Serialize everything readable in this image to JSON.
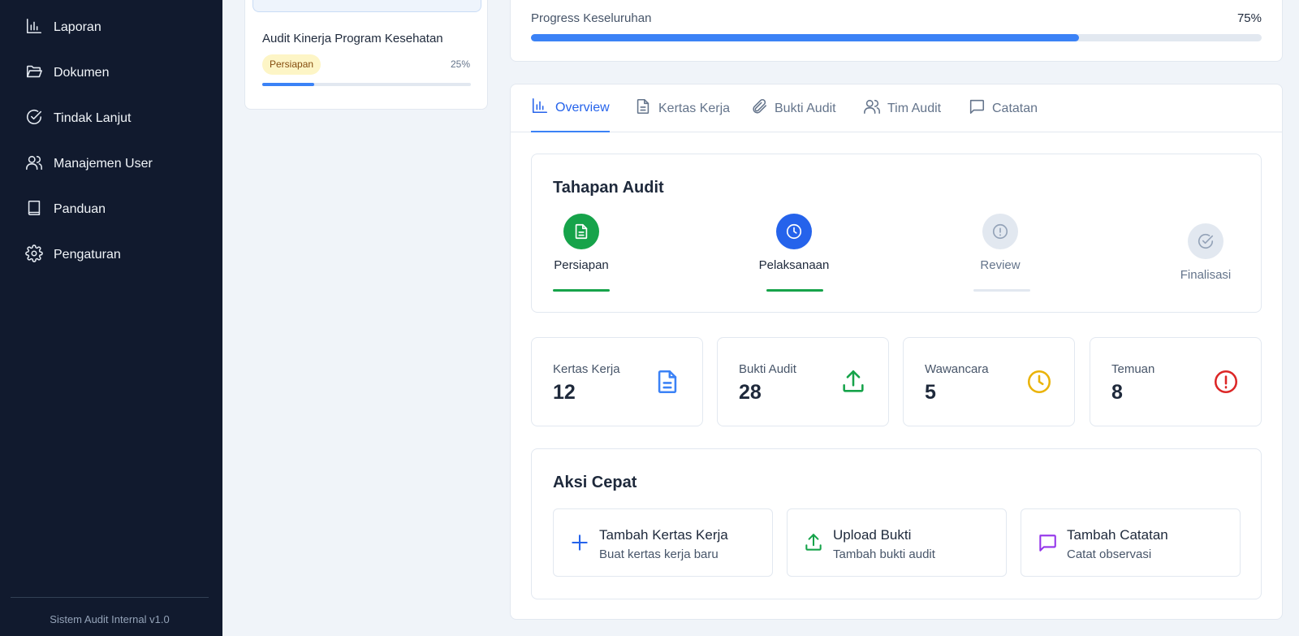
{
  "sidebar": {
    "items": [
      {
        "label": "Laporan",
        "icon": "bar-chart-icon"
      },
      {
        "label": "Dokumen",
        "icon": "folder-open-icon"
      },
      {
        "label": "Tindak Lanjut",
        "icon": "check-circle-icon"
      },
      {
        "label": "Manajemen User",
        "icon": "users-icon"
      },
      {
        "label": "Panduan",
        "icon": "book-icon"
      },
      {
        "label": "Pengaturan",
        "icon": "gear-icon"
      }
    ],
    "footer": "Sistem Audit Internal v1.0"
  },
  "audit_list": {
    "item": {
      "title": "Audit Kinerja Program Kesehatan",
      "status": "Persiapan",
      "progress_label": "25%",
      "progress": 0.25
    }
  },
  "progress": {
    "label": "Progress Keseluruhan",
    "value_label": "75%",
    "value": 0.75
  },
  "tabs": [
    {
      "label": "Overview",
      "icon": "bar-chart-icon",
      "active": true
    },
    {
      "label": "Kertas Kerja",
      "icon": "document-icon",
      "active": false
    },
    {
      "label": "Bukti Audit",
      "icon": "paperclip-icon",
      "active": false
    },
    {
      "label": "Tim Audit",
      "icon": "users-icon",
      "active": false
    },
    {
      "label": "Catatan",
      "icon": "message-icon",
      "active": false
    }
  ],
  "stages": {
    "title": "Tahapan Audit",
    "steps": [
      {
        "label": "Persiapan",
        "icon": "document-icon",
        "status": "done",
        "color": "#16a34a"
      },
      {
        "label": "Pelaksanaan",
        "icon": "clock-icon",
        "status": "current",
        "color": "#2563eb"
      },
      {
        "label": "Review",
        "icon": "alert-circle-icon",
        "status": "pending",
        "color": "#e2e8f0"
      },
      {
        "label": "Finalisasi",
        "icon": "check-circle-icon",
        "status": "pending",
        "color": "#e2e8f0"
      }
    ]
  },
  "stats": [
    {
      "label": "Kertas Kerja",
      "value": "12",
      "icon": "document-icon",
      "color": "#3b82f6"
    },
    {
      "label": "Bukti Audit",
      "value": "28",
      "icon": "upload-icon",
      "color": "#16a34a"
    },
    {
      "label": "Wawancara",
      "value": "5",
      "icon": "clock-icon",
      "color": "#eab308"
    },
    {
      "label": "Temuan",
      "value": "8",
      "icon": "alert-circle-icon",
      "color": "#dc2626"
    }
  ],
  "quick_actions": {
    "title": "Aksi Cepat",
    "items": [
      {
        "title": "Tambah Kertas Kerja",
        "subtitle": "Buat kertas kerja baru",
        "icon": "plus-icon",
        "color": "#2563eb"
      },
      {
        "title": "Upload Bukti",
        "subtitle": "Tambah bukti audit",
        "icon": "upload-icon",
        "color": "#16a34a"
      },
      {
        "title": "Tambah Catatan",
        "subtitle": "Catat observasi",
        "icon": "message-icon",
        "color": "#9333ea"
      }
    ]
  }
}
